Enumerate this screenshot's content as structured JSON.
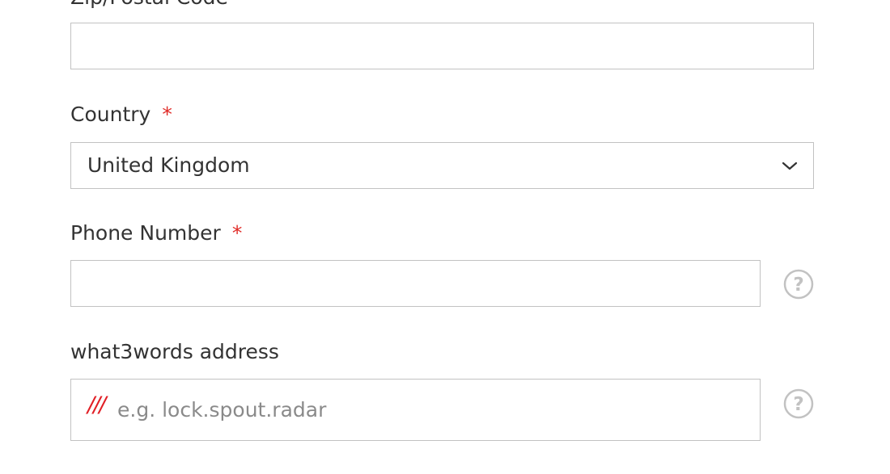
{
  "zip": {
    "label": "Zip/Postal Code",
    "value": ""
  },
  "country": {
    "label": "Country",
    "required_mark": "*",
    "selected": "United Kingdom"
  },
  "phone": {
    "label": "Phone Number",
    "required_mark": "*",
    "value": ""
  },
  "what3words": {
    "label": "what3words address",
    "prefix": "///",
    "placeholder": "e.g. lock.spout.radar"
  },
  "icons": {
    "help": "question-circle-icon",
    "dropdown": "chevron-down-icon"
  },
  "colors": {
    "required": "#e02b27",
    "w3w_brand": "#e11f26",
    "border": "#c2c2c2",
    "text": "#333333",
    "placeholder": "#8a8a8a"
  }
}
